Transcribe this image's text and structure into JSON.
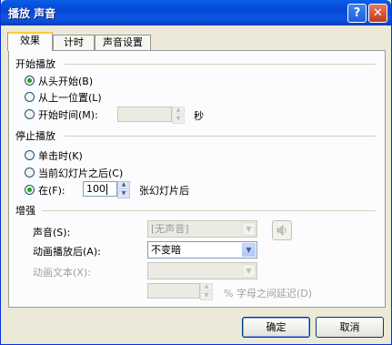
{
  "window": {
    "title": "播放 声音",
    "help_label": "?",
    "close_label": "✕"
  },
  "tabs": [
    {
      "label": "效果"
    },
    {
      "label": "计时"
    },
    {
      "label": "声音设置"
    }
  ],
  "start": {
    "group": "开始播放",
    "options": [
      "从头开始(B)",
      "从上一位置(L)",
      "开始时间(M):"
    ],
    "time_value": "",
    "seconds_label": "秒"
  },
  "stop": {
    "group": "停止播放",
    "options": [
      "单击时(K)",
      "当前幻灯片之后(C)",
      "在(F):"
    ],
    "count_value": "100",
    "slides_after": "张幻灯片后"
  },
  "enhance": {
    "group": "增强",
    "sound_label": "声音(S):",
    "sound_value": "[无声音]",
    "after_label": "动画播放后(A):",
    "after_value": "不变暗",
    "text_label": "动画文本(X):",
    "text_value": "",
    "delay_value": "",
    "delay_label": "% 字母之间延迟(D)"
  },
  "buttons": {
    "ok": "确定",
    "cancel": "取消"
  }
}
